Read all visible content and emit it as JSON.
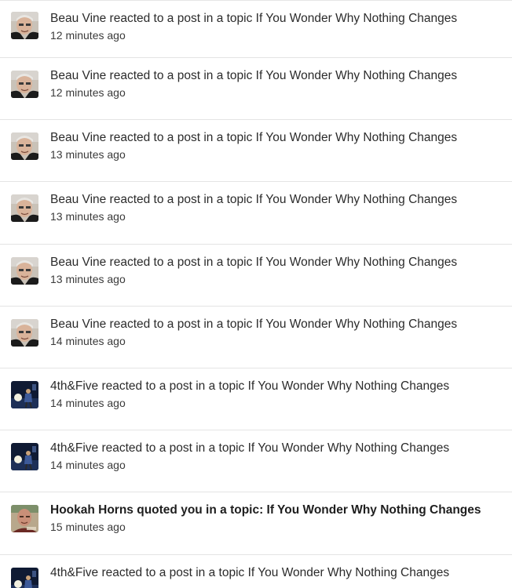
{
  "notifications": [
    {
      "text": "Beau Vine reacted to a post in a topic If You Wonder Why Nothing Changes",
      "time": "12 minutes ago",
      "avatar": "beau-vine-avatar",
      "bold": false
    },
    {
      "text": "Beau Vine reacted to a post in a topic If You Wonder Why Nothing Changes",
      "time": "12 minutes ago",
      "avatar": "beau-vine-avatar",
      "bold": false
    },
    {
      "text": "Beau Vine reacted to a post in a topic If You Wonder Why Nothing Changes",
      "time": "13 minutes ago",
      "avatar": "beau-vine-avatar",
      "bold": false
    },
    {
      "text": "Beau Vine reacted to a post in a topic If You Wonder Why Nothing Changes",
      "time": "13 minutes ago",
      "avatar": "beau-vine-avatar",
      "bold": false
    },
    {
      "text": "Beau Vine reacted to a post in a topic If You Wonder Why Nothing Changes",
      "time": "13 minutes ago",
      "avatar": "beau-vine-avatar",
      "bold": false
    },
    {
      "text": "Beau Vine reacted to a post in a topic If You Wonder Why Nothing Changes",
      "time": "14 minutes ago",
      "avatar": "beau-vine-avatar",
      "bold": false
    },
    {
      "text": "4th&Five reacted to a post in a topic If You Wonder Why Nothing Changes",
      "time": "14 minutes ago",
      "avatar": "4th-and-five-avatar",
      "bold": false
    },
    {
      "text": "4th&Five reacted to a post in a topic If You Wonder Why Nothing Changes",
      "time": "14 minutes ago",
      "avatar": "4th-and-five-avatar",
      "bold": false
    },
    {
      "text": "Hookah Horns quoted you in a topic: If You Wonder Why Nothing Changes",
      "time": "15 minutes ago",
      "avatar": "hookah-horns-avatar",
      "bold": true
    },
    {
      "text": "4th&Five reacted to a post in a topic If You Wonder Why Nothing Changes",
      "time": "",
      "avatar": "4th-and-five-avatar",
      "bold": false
    }
  ]
}
